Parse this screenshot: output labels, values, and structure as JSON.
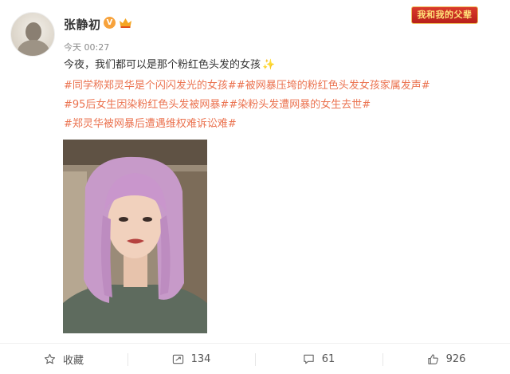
{
  "author": {
    "name": "张静初",
    "vip_badge": "V",
    "timestamp": "今天 00:27"
  },
  "topic_banner": {
    "label": "我和我的父辈"
  },
  "post": {
    "text": "今夜，我们都可以是那个粉红色头发的女孩",
    "hashtag_color": "#eb7350",
    "hashtags": [
      "#同学称郑灵华是个闪闪发光的女孩#",
      "#被网暴压垮的粉红色头发女孩家属发声#",
      "#95后女生因染粉红色头发被网暴#",
      "#染粉头发遭网暴的女生去世#",
      "#郑灵华被网暴后遭遇维权难诉讼难#"
    ]
  },
  "actions": {
    "favorite_label": "收藏",
    "repost_count": "134",
    "comment_count": "61",
    "like_count": "926"
  }
}
